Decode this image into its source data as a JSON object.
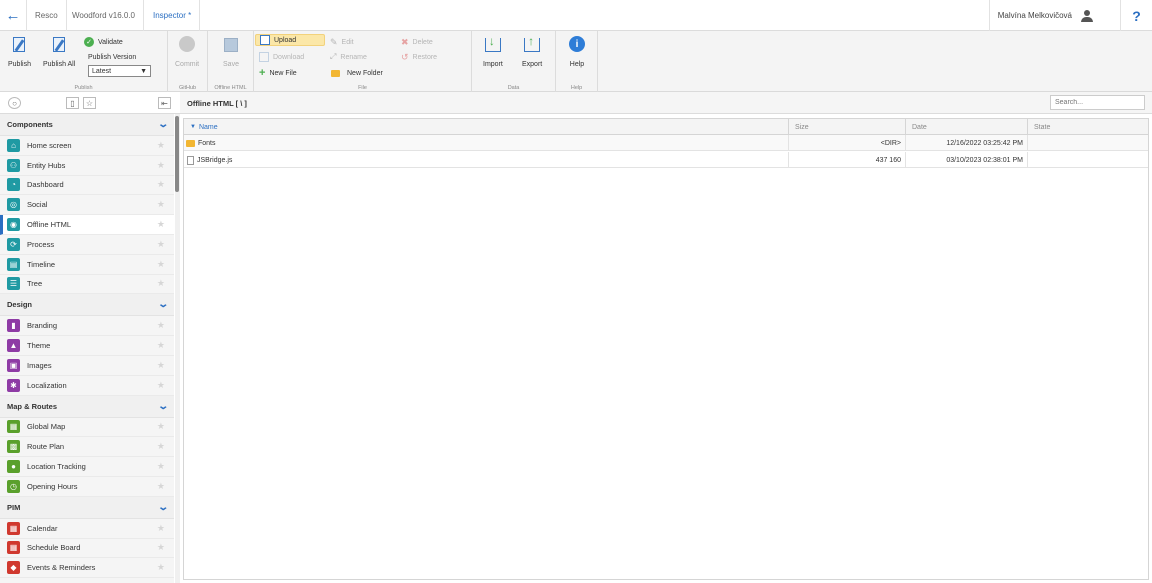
{
  "topbar": {
    "crumbs": [
      "Resco",
      "Woodford v16.0.0",
      "Inspector *"
    ],
    "user": "Malvína Melkovičová",
    "help": "?"
  },
  "ribbon": {
    "publish": {
      "publish": "Publish",
      "publish_all": "Publish All",
      "validate": "Validate",
      "publish_version": "Publish Version",
      "version_value": "Latest",
      "group": "Publish"
    },
    "github": {
      "commit": "Commit",
      "group": "GitHub"
    },
    "offline": {
      "save": "Save",
      "group": "Offline HTML"
    },
    "file": {
      "upload": "Upload",
      "download": "Download",
      "new_file": "New File",
      "edit": "Edit",
      "rename": "Rename",
      "new_folder": "New Folder",
      "delete": "Delete",
      "restore": "Restore",
      "group": "File"
    },
    "data": {
      "import": "Import",
      "export": "Export",
      "group": "Data"
    },
    "help": {
      "help": "Help",
      "group": "Help"
    }
  },
  "sidebar": {
    "sections": [
      {
        "title": "Components",
        "items": [
          {
            "label": "Home screen",
            "color": "#1f9aa3"
          },
          {
            "label": "Entity Hubs",
            "color": "#1f9aa3"
          },
          {
            "label": "Dashboard",
            "color": "#1f9aa3"
          },
          {
            "label": "Social",
            "color": "#1f9aa3"
          },
          {
            "label": "Offline HTML",
            "color": "#1f9aa3",
            "active": true
          },
          {
            "label": "Process",
            "color": "#1f9aa3"
          },
          {
            "label": "Timeline",
            "color": "#1f9aa3"
          },
          {
            "label": "Tree",
            "color": "#1f9aa3"
          }
        ]
      },
      {
        "title": "Design",
        "items": [
          {
            "label": "Branding",
            "color": "#8e3ba5"
          },
          {
            "label": "Theme",
            "color": "#8e3ba5"
          },
          {
            "label": "Images",
            "color": "#8e3ba5"
          },
          {
            "label": "Localization",
            "color": "#8e3ba5"
          }
        ]
      },
      {
        "title": "Map & Routes",
        "items": [
          {
            "label": "Global Map",
            "color": "#5aa02c"
          },
          {
            "label": "Route Plan",
            "color": "#5aa02c"
          },
          {
            "label": "Location Tracking",
            "color": "#5aa02c"
          },
          {
            "label": "Opening Hours",
            "color": "#5aa02c"
          }
        ]
      },
      {
        "title": "PIM",
        "items": [
          {
            "label": "Calendar",
            "color": "#d0392f"
          },
          {
            "label": "Schedule Board",
            "color": "#d0392f"
          },
          {
            "label": "Events & Reminders",
            "color": "#d0392f"
          }
        ]
      }
    ]
  },
  "main": {
    "path": "Offline HTML [ \\ ]",
    "search_placeholder": "Search...",
    "columns": [
      "Name",
      "Size",
      "Date",
      "State"
    ],
    "rows": [
      {
        "name": "Fonts",
        "type": "folder",
        "size": "<DIR>",
        "date": "12/16/2022 03:25:42 PM",
        "state": ""
      },
      {
        "name": "JSBridge.js",
        "type": "file",
        "size": "437 160",
        "date": "03/10/2023 02:38:01 PM",
        "state": ""
      }
    ]
  }
}
